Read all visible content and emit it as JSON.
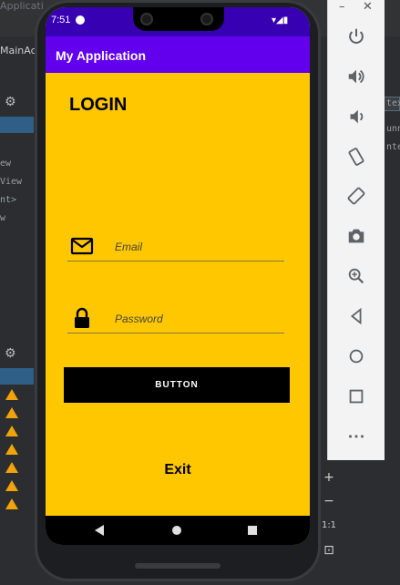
{
  "ide": {
    "title": "Applicati",
    "tab": "MainAc",
    "code_lines": [
      "ew",
      "View",
      "nt>",
      "w"
    ],
    "right_code": [
      "tex",
      "unn",
      "ntex"
    ]
  },
  "status_bar": {
    "time": "7:51"
  },
  "app_bar": {
    "title": "My Application"
  },
  "login": {
    "heading": "LOGIN",
    "email_placeholder": "Email",
    "password_placeholder": "Password",
    "button_label": "BUTTON",
    "exit_label": "Exit"
  },
  "emulator": {
    "zoom_in": "+",
    "zoom_out": "−",
    "zoom_reset": "1:1",
    "more": "•••"
  },
  "colors": {
    "status_bar": "#3700b3",
    "app_bar": "#6200ee",
    "screen_bg": "#ffc700",
    "button_bg": "#000000"
  }
}
